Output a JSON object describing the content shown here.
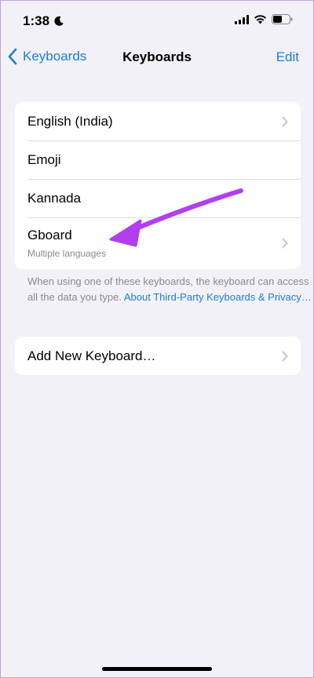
{
  "status_bar": {
    "time": "1:38",
    "icons": [
      "moon-icon",
      "signal-icon",
      "wifi-icon",
      "battery-icon"
    ]
  },
  "nav": {
    "back_label": "Keyboards",
    "title": "Keyboards",
    "edit_label": "Edit"
  },
  "keyboards": [
    {
      "label": "English (India)",
      "subtitle": "",
      "has_chevron": true
    },
    {
      "label": "Emoji",
      "subtitle": "",
      "has_chevron": false
    },
    {
      "label": "Kannada",
      "subtitle": "",
      "has_chevron": false
    },
    {
      "label": "Gboard",
      "subtitle": "Multiple languages",
      "has_chevron": true
    }
  ],
  "footnote": {
    "text": "When using one of these keyboards, the keyboard can access all the data you type. ",
    "link": "About Third-Party Keyboards & Privacy…"
  },
  "add_keyboard": {
    "label": "Add New Keyboard…"
  },
  "colors": {
    "accent": "#1a7fd6",
    "background": "#f2f1f7",
    "annotation_arrow": "#b13ff0"
  }
}
